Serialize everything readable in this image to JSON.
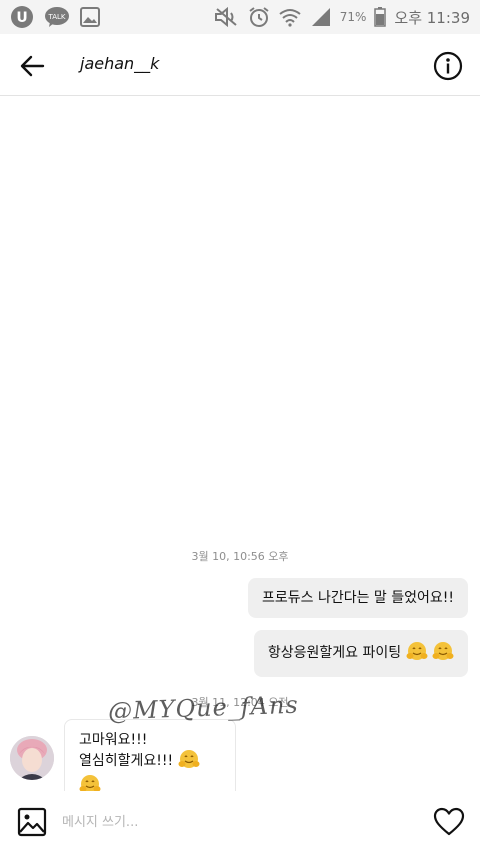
{
  "status_bar": {
    "battery": "71%",
    "time": "오후 11:39",
    "icons": [
      "u-plus-icon",
      "kakaotalk-icon",
      "gallery-icon",
      "mute-icon",
      "alarm-icon",
      "wifi-icon",
      "signal-icon",
      "battery-icon"
    ],
    "app_badge": "TALK"
  },
  "header": {
    "title": "jaehan__k",
    "back_icon": "arrow-left-icon",
    "info_icon": "info-icon"
  },
  "messages": {
    "timestamp_1": "3월 10, 10:56 오후",
    "sent_1": "프로듀스 나간다는 말 들었어요!!",
    "sent_2": "항상응원할게요  파이팅",
    "timestamp_2": "3월 11, 12:04 오전",
    "received_line_1": "고마워요!!!",
    "received_line_2": "열심히할게요!!!"
  },
  "watermark": "@MYQue_fAns",
  "composer": {
    "placeholder": "메시지 쓰기...",
    "gallery_icon": "image-icon",
    "heart_icon": "heart-icon"
  },
  "colors": {
    "sent_bubble": "#efefef",
    "text": "#262626",
    "timestamp": "#8e8e8e",
    "status_bar": "#f4f4f4"
  }
}
